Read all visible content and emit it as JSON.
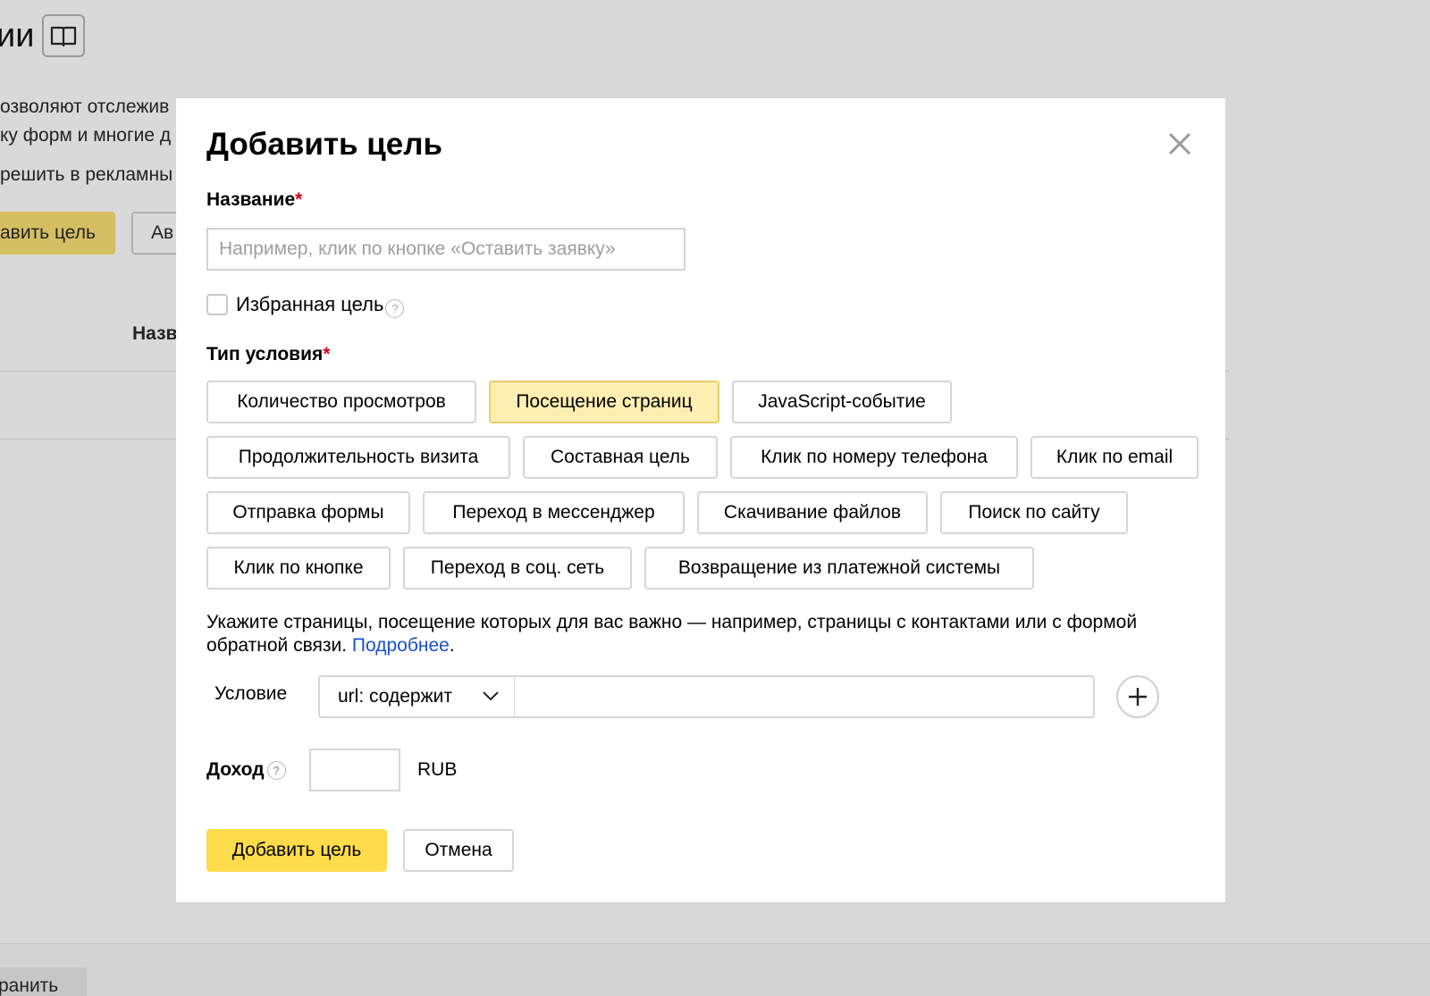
{
  "background": {
    "title_fragment": "ии",
    "text_lines": [
      "озволяют отслежив",
      "ку форм и многие д",
      "решить в рекламны"
    ],
    "add_goal_button": "авить цель",
    "auto_button": "Ав",
    "column_header": "Назв",
    "save_button": "ранить"
  },
  "modal": {
    "title": "Добавить цель",
    "name_label": "Название",
    "required_mark": "*",
    "name_placeholder": "Например, клик по кнопке «Оставить заявку»",
    "name_value": "",
    "favorite_label": "Избранная цель",
    "favorite_checked": false,
    "condition_type_label": "Тип условия",
    "condition_types": [
      {
        "label": "Количество просмотров",
        "active": false
      },
      {
        "label": "Посещение страниц",
        "active": true
      },
      {
        "label": "JavaScript-событие",
        "active": false
      },
      {
        "label": "Продолжительность визита",
        "active": false
      },
      {
        "label": "Составная цель",
        "active": false
      },
      {
        "label": "Клик по номеру телефона",
        "active": false
      },
      {
        "label": "Клик по email",
        "active": false
      },
      {
        "label": "Отправка формы",
        "active": false
      },
      {
        "label": "Переход в мессенджер",
        "active": false
      },
      {
        "label": "Скачивание файлов",
        "active": false
      },
      {
        "label": "Поиск по сайту",
        "active": false
      },
      {
        "label": "Клик по кнопке",
        "active": false
      },
      {
        "label": "Переход в соц. сеть",
        "active": false
      },
      {
        "label": "Возвращение из платежной системы",
        "active": false
      }
    ],
    "hint_text": "Укажите страницы, посещение которых для вас важно — например, страницы с контактами или с формой обратной связи. ",
    "hint_link": "Подробнее",
    "hint_end": ".",
    "condition_label": "Условие",
    "condition_select_value": "url: содержит",
    "condition_value": "",
    "income_label": "Доход",
    "income_value": "",
    "currency": "RUB",
    "submit_button": "Добавить цель",
    "cancel_button": "Отмена",
    "help_glyph": "?"
  },
  "colors": {
    "primary_button": "#fddb4b",
    "active_type_bg": "#fdeeb1",
    "link": "#1c4fc4",
    "required": "#d0021b",
    "overlay_bg": "#d9d9d9"
  },
  "icons": [
    "book-icon",
    "close-icon",
    "help-icon",
    "chevron-down-icon",
    "plus-icon"
  ]
}
